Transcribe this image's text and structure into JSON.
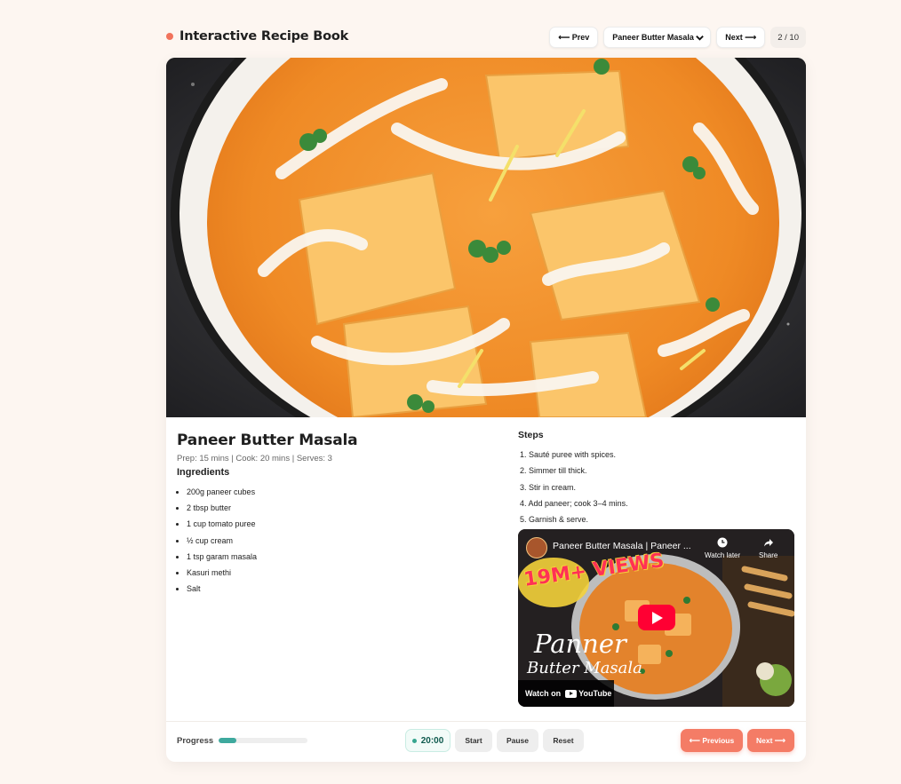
{
  "app": {
    "title": "Interactive Recipe Book",
    "accent": "#f1735c"
  },
  "nav": {
    "prev_label": "⟵ Prev",
    "selected_recipe": "Paneer Butter Masala",
    "next_label": "Next ⟶",
    "counter": "2 / 10"
  },
  "recipe": {
    "title": "Paneer Butter Masala",
    "meta": "Prep: 15 mins | Cook: 20 mins | Serves: 3",
    "ingredients_heading": "Ingredients",
    "ingredients": [
      "200g paneer cubes",
      "2 tbsp butter",
      "1 cup tomato puree",
      "½ cup cream",
      "1 tsp garam masala",
      "Kasuri methi",
      "Salt"
    ],
    "steps_heading": "Steps",
    "steps": [
      "1. Sauté puree with spices.",
      "2. Simmer till thick.",
      "3. Stir in cream.",
      "4. Add paneer; cook 3–4 mins.",
      "5. Garnish & serve."
    ]
  },
  "video": {
    "title": "Paneer Butter Masala | Paneer ...",
    "watch_later": "Watch later",
    "share": "Share",
    "badge": "19M+ VIEWS",
    "overlay_line1": "Panner",
    "overlay_line2": "Butter Masala",
    "watch_on": "Watch on",
    "platform": "YouTube",
    "icons": [
      "clock-icon",
      "share-icon",
      "play-icon",
      "youtube-logo"
    ]
  },
  "footer": {
    "progress_label": "Progress",
    "progress_fraction": 0.2,
    "progress_color": "#3ea99e",
    "timer": "20:00",
    "start_label": "Start",
    "pause_label": "Pause",
    "reset_label": "Reset",
    "previous_label": "⟵ Previous",
    "next_label": "Next ⟶"
  }
}
